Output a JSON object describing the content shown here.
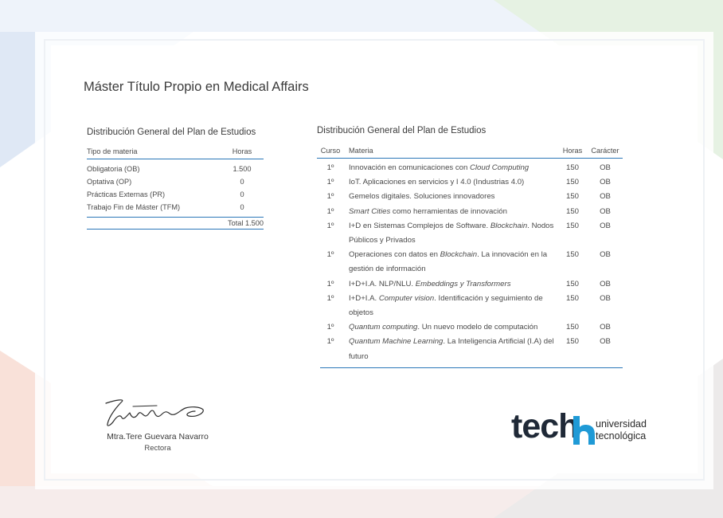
{
  "document": {
    "title": "Máster Título Propio en Medical Affairs"
  },
  "summary": {
    "heading": "Distribución General del Plan de Estudios",
    "col_type": "Tipo de materia",
    "col_hours": "Horas",
    "rows": [
      {
        "type": "Obligatoria (OB)",
        "hours": "1.500"
      },
      {
        "type": "Optativa (OP)",
        "hours": "0"
      },
      {
        "type": "Prácticas Externas (PR)",
        "hours": "0"
      },
      {
        "type": "Trabajo Fin de Máster (TFM)",
        "hours": "0"
      }
    ],
    "total": "Total 1.500"
  },
  "detail": {
    "heading": "Distribución General del Plan de Estudios",
    "col_curso": "Curso",
    "col_materia": "Materia",
    "col_horas": "Horas",
    "col_caracter": "Carácter",
    "rows": [
      {
        "curso": "1º",
        "materia": [
          [
            "Innovación en comunicaciones con ",
            false
          ],
          [
            "Cloud Computing",
            true
          ]
        ],
        "horas": "150",
        "caracter": "OB"
      },
      {
        "curso": "1º",
        "materia": [
          [
            "IoT. Aplicaciones en servicios y I 4.0 (Industrias 4.0)",
            false
          ]
        ],
        "horas": "150",
        "caracter": "OB"
      },
      {
        "curso": "1º",
        "materia": [
          [
            "Gemelos digitales. Soluciones innovadores",
            false
          ]
        ],
        "horas": "150",
        "caracter": "OB"
      },
      {
        "curso": "1º",
        "materia": [
          [
            "Smart Cities",
            true
          ],
          [
            " como herramientas de innovación",
            false
          ]
        ],
        "horas": "150",
        "caracter": "OB"
      },
      {
        "curso": "1º",
        "materia": [
          [
            "I+D en Sistemas Complejos de Software. ",
            false
          ],
          [
            "Blockchain",
            true
          ],
          [
            ". Nodos Públicos y Privados",
            false
          ]
        ],
        "horas": "150",
        "caracter": "OB"
      },
      {
        "curso": "1º",
        "materia": [
          [
            "Operaciones con datos en ",
            false
          ],
          [
            "Blockchain",
            true
          ],
          [
            ". La innovación en la gestión de información",
            false
          ]
        ],
        "horas": "150",
        "caracter": "OB"
      },
      {
        "curso": "1º",
        "materia": [
          [
            "I+D+I.A. NLP/NLU. ",
            false
          ],
          [
            "Embeddings y Transformers",
            true
          ]
        ],
        "horas": "150",
        "caracter": "OB"
      },
      {
        "curso": "1º",
        "materia": [
          [
            "I+D+I.A. ",
            false
          ],
          [
            "Computer vision",
            true
          ],
          [
            ". Identificación y seguimiento de objetos",
            false
          ]
        ],
        "horas": "150",
        "caracter": "OB"
      },
      {
        "curso": "1º",
        "materia": [
          [
            "Quantum computing",
            true
          ],
          [
            ". Un nuevo modelo de computación",
            false
          ]
        ],
        "horas": "150",
        "caracter": "OB"
      },
      {
        "curso": "1º",
        "materia": [
          [
            "Quantum Machine Learning",
            true
          ],
          [
            ". La Inteligencia Artificial (I.A) del futuro",
            false
          ]
        ],
        "horas": "150",
        "caracter": "OB"
      }
    ]
  },
  "signature": {
    "name": "Mtra.Tere Guevara Navarro",
    "role": "Rectora"
  },
  "logo": {
    "wordmark": "tech",
    "line1": "universidad",
    "line2": "tecnológica",
    "accent_color": "#1f9ad6",
    "dark_color": "#1f2937"
  }
}
